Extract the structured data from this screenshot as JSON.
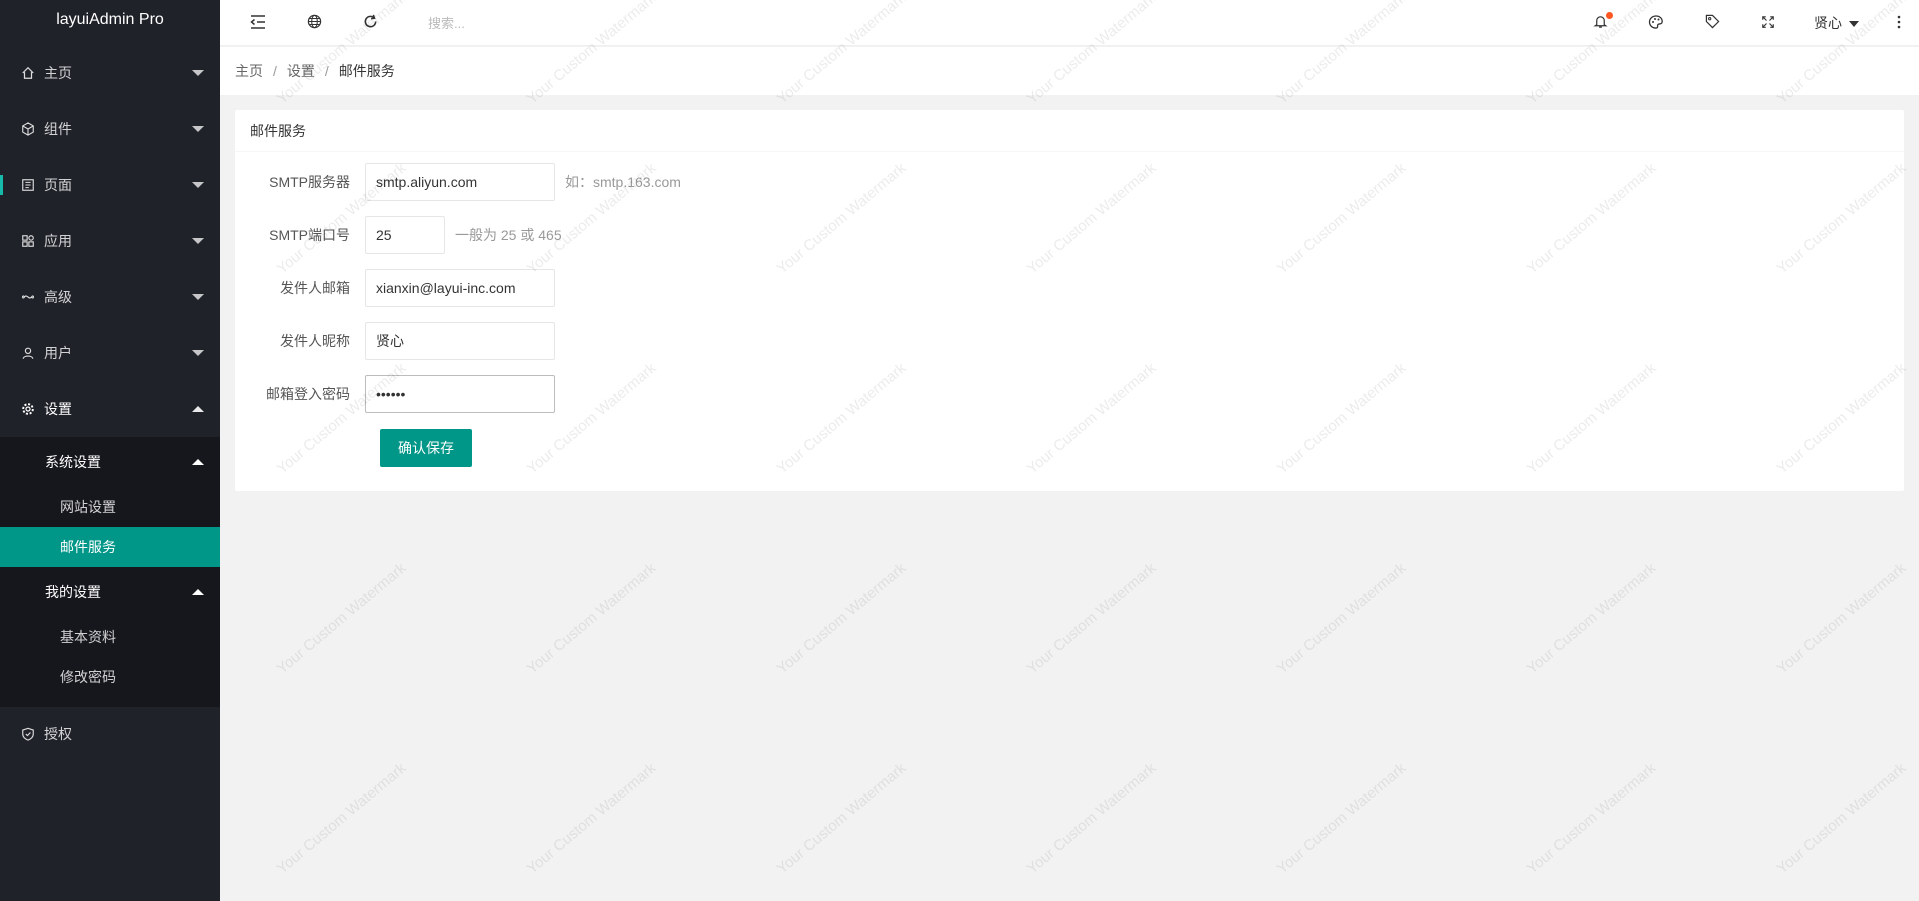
{
  "app": {
    "title": "layuiAdmin Pro"
  },
  "sidebar": {
    "items": [
      {
        "label": "主页",
        "icon": "home-icon"
      },
      {
        "label": "组件",
        "icon": "cube-icon"
      },
      {
        "label": "页面",
        "icon": "page-icon"
      },
      {
        "label": "应用",
        "icon": "app-icon"
      },
      {
        "label": "高级",
        "icon": "infinity-icon"
      },
      {
        "label": "用户",
        "icon": "user-icon"
      },
      {
        "label": "设置",
        "icon": "gear-icon"
      },
      {
        "label": "授权",
        "icon": "shield-icon"
      }
    ],
    "groups": [
      {
        "label": "系统设置",
        "items": [
          "网站设置",
          "邮件服务"
        ]
      },
      {
        "label": "我的设置",
        "items": [
          "基本资料",
          "修改密码"
        ]
      }
    ]
  },
  "header": {
    "search_placeholder": "搜索...",
    "user": "贤心"
  },
  "breadcrumb": [
    "主页",
    "设置",
    "邮件服务"
  ],
  "card": {
    "title": "邮件服务",
    "fields": [
      {
        "label": "SMTP服务器",
        "value": "smtp.aliyun.com",
        "tip": "如：smtp.163.com"
      },
      {
        "label": "SMTP端口号",
        "value": "25",
        "tip": "一般为 25 或 465"
      },
      {
        "label": "发件人邮箱",
        "value": "xianxin@layui-inc.com",
        "tip": ""
      },
      {
        "label": "发件人昵称",
        "value": "贤心",
        "tip": ""
      },
      {
        "label": "邮箱登入密码",
        "value": "••••••",
        "tip": ""
      }
    ],
    "submit_label": "确认保存"
  },
  "watermark": "Your Custom Watermark",
  "colors": {
    "accent": "#009688",
    "sidebar_bg": "#20222a",
    "badge": "#ff5722"
  }
}
